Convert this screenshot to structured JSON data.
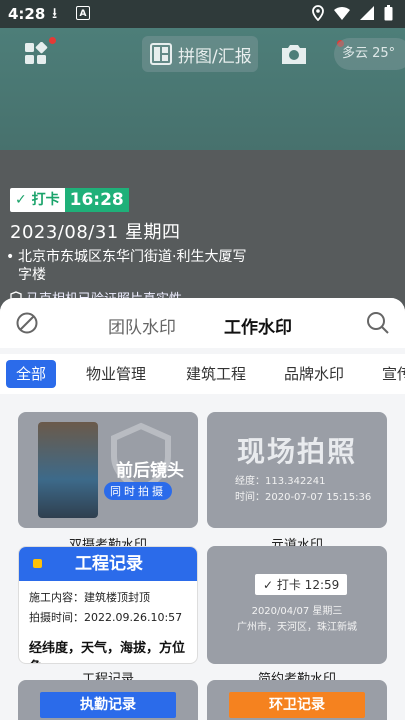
{
  "status_bar": {
    "time": "4:28"
  },
  "toolbar": {
    "collage_label": "拼图/汇报",
    "weather": "多云 25°"
  },
  "watermark": {
    "punch_label": "打卡",
    "punch_time": "16:28",
    "date": "2023/08/31 星期四",
    "address": "北京市东城区东华门街道·利生大厦写字楼",
    "verify": "马克相机已验证照片真实性"
  },
  "sheet": {
    "tabs": [
      "团队水印",
      "工作水印"
    ],
    "categories": [
      "全部",
      "物业管理",
      "建筑工程",
      "品牌水印",
      "宣传"
    ],
    "cards": [
      {
        "label": "双摄考勤水印",
        "title": "前后镜头",
        "subtitle": "同时拍摄"
      },
      {
        "label": "亓道水印",
        "title": "现场拍照",
        "line1": "经度：113.342241",
        "line2": "时间：2020-07-07 15:15:36"
      },
      {
        "label": "工程记录",
        "title": "工程记录",
        "line1": "施工内容：建筑楼顶封顶",
        "line2": "拍摄时间：2022.09.26.10:57",
        "line3": "经纬度，天气，海拔，方位角"
      },
      {
        "label": "简约考勤水印",
        "badge": "✓ 打卡 12:59",
        "line1": "2020/04/07 星期三",
        "line2": "广州市，天河区，珠江新城"
      },
      {
        "title": "执勤记录"
      },
      {
        "title": "环卫记录"
      }
    ]
  },
  "colors": {
    "accent": "#2b6bea",
    "punch_green": "#1fb079",
    "orange": "#f5821f"
  }
}
